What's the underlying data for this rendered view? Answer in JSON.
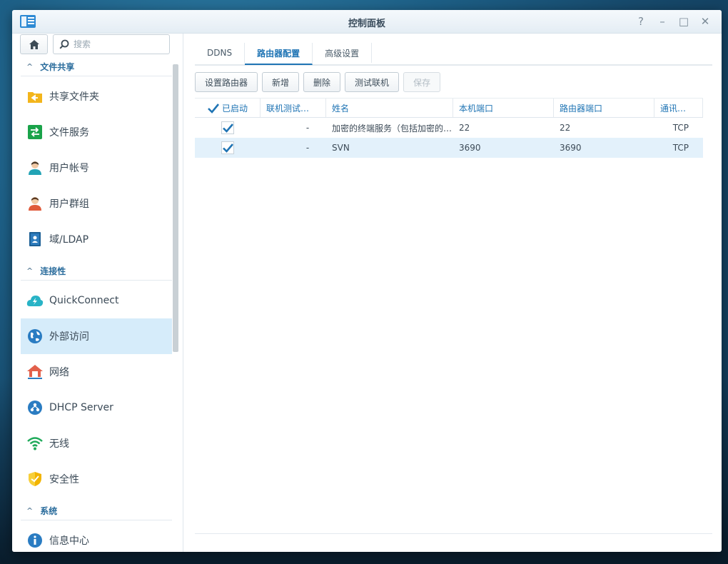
{
  "window": {
    "title": "控制面板",
    "controls": [
      "?",
      "–",
      "□",
      "✕"
    ]
  },
  "sidebar": {
    "search_placeholder": "搜索",
    "sections": {
      "file_sharing": "文件共享",
      "connectivity": "连接性",
      "system": "系统"
    },
    "items": {
      "shared_folder": "共享文件夹",
      "file_services": "文件服务",
      "user": "用户帐号",
      "group": "用户群组",
      "domain": "域/LDAP",
      "quickconnect": "QuickConnect",
      "external_access": "外部访问",
      "network": "网络",
      "dhcp": "DHCP Server",
      "wireless": "无线",
      "security": "安全性",
      "info_center": "信息中心"
    }
  },
  "main": {
    "tabs": [
      "DDNS",
      "路由器配置",
      "高级设置"
    ],
    "toolbar": {
      "setup_router": "设置路由器",
      "create": "新增",
      "delete": "删除",
      "test": "测试联机",
      "save": "保存"
    },
    "columns": {
      "enabled": "已启动",
      "test": "联机测试…",
      "name": "姓名",
      "local_port": "本机端口",
      "router_port": "路由器端口",
      "protocol": "通讯…"
    },
    "rows": [
      {
        "enabled": true,
        "test": "-",
        "name": "加密的终端服务（包括加密的…",
        "local_port": "22",
        "router_port": "22",
        "protocol": "TCP"
      },
      {
        "enabled": true,
        "test": "-",
        "name": "SVN",
        "local_port": "3690",
        "router_port": "3690",
        "protocol": "TCP"
      }
    ]
  },
  "colors": {
    "accent": "#1f74b4",
    "selected_row": "#e3f1fb",
    "active_nav": "#d6ecfa"
  }
}
